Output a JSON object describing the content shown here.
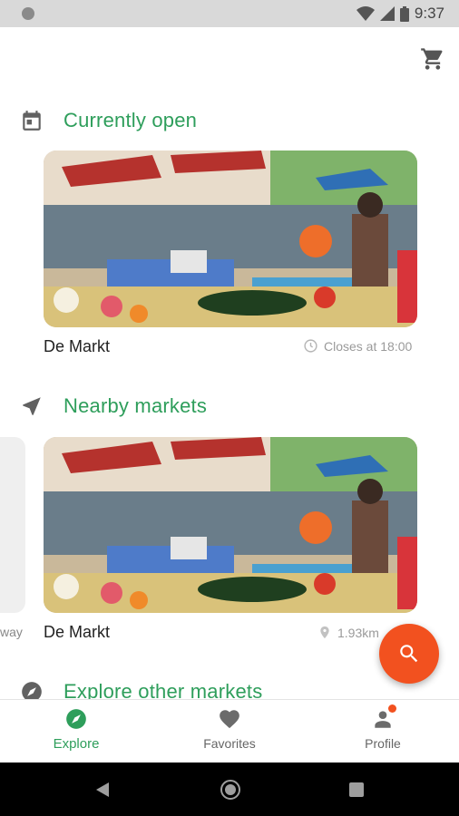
{
  "status_bar": {
    "time": "9:37"
  },
  "header": {
    "cart_icon": "shopping-cart-icon"
  },
  "sections": {
    "open": {
      "title": "Currently open",
      "icon": "calendar-icon"
    },
    "nearby": {
      "title": "Nearby markets",
      "icon": "navigation-arrow-icon"
    },
    "explore": {
      "title": "Explore other markets",
      "icon": "compass-icon"
    }
  },
  "open_market": {
    "name": "De Markt",
    "status": "Closes at 18:00"
  },
  "nearby_market": {
    "name": "De Markt",
    "distance": "1.93km"
  },
  "peek_card": {
    "text": "way"
  },
  "fab": {
    "icon": "search-icon"
  },
  "bottom_nav": {
    "items": [
      {
        "label": "Explore",
        "active": true
      },
      {
        "label": "Favorites",
        "active": false
      },
      {
        "label": "Profile",
        "active": false
      }
    ]
  },
  "colors": {
    "accent": "#2e9e5b",
    "fab": "#f2511f"
  }
}
